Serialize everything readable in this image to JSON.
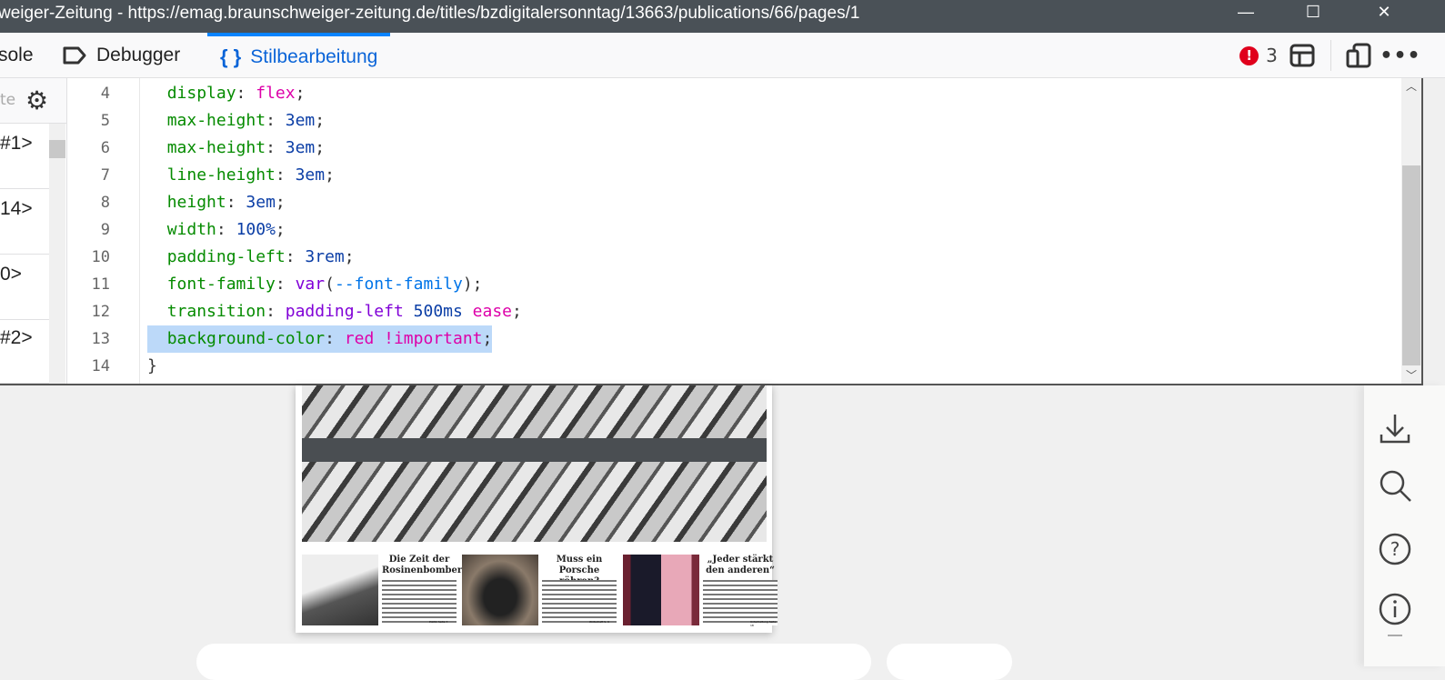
{
  "window": {
    "title": "weiger-Zeitung - https://emag.braunschweiger-zeitung.de/titles/bzdigitalersonntag/13663/publications/66/pages/1"
  },
  "devtools": {
    "tabs": [
      {
        "label": "sole",
        "icon": "console-icon"
      },
      {
        "label": "Debugger",
        "icon": "debugger-icon"
      },
      {
        "label": "Stilbearbeitung",
        "icon": "braces-icon",
        "active": true
      }
    ],
    "error_count": "3",
    "filter_placeholder": "te",
    "stylesheets": [
      "#1>",
      "14>",
      "0>",
      "#2>"
    ],
    "code_lines": [
      {
        "n": "4",
        "tokens": [
          [
            "  ",
            "punct"
          ],
          [
            "display",
            "prop"
          ],
          [
            ": ",
            "punct"
          ],
          [
            "flex",
            "kw"
          ],
          [
            ";",
            "punct"
          ]
        ]
      },
      {
        "n": "5",
        "tokens": [
          [
            "  ",
            "punct"
          ],
          [
            "max-height",
            "prop"
          ],
          [
            ": ",
            "punct"
          ],
          [
            "3em",
            "num"
          ],
          [
            ";",
            "punct"
          ]
        ]
      },
      {
        "n": "6",
        "tokens": [
          [
            "  ",
            "punct"
          ],
          [
            "max-height",
            "prop"
          ],
          [
            ": ",
            "punct"
          ],
          [
            "3em",
            "num"
          ],
          [
            ";",
            "punct"
          ]
        ]
      },
      {
        "n": "7",
        "tokens": [
          [
            "  ",
            "punct"
          ],
          [
            "line-height",
            "prop"
          ],
          [
            ": ",
            "punct"
          ],
          [
            "3em",
            "num"
          ],
          [
            ";",
            "punct"
          ]
        ]
      },
      {
        "n": "8",
        "tokens": [
          [
            "  ",
            "punct"
          ],
          [
            "height",
            "prop"
          ],
          [
            ": ",
            "punct"
          ],
          [
            "3em",
            "num"
          ],
          [
            ";",
            "punct"
          ]
        ]
      },
      {
        "n": "9",
        "tokens": [
          [
            "  ",
            "punct"
          ],
          [
            "width",
            "prop"
          ],
          [
            ": ",
            "punct"
          ],
          [
            "100%",
            "num"
          ],
          [
            ";",
            "punct"
          ]
        ]
      },
      {
        "n": "10",
        "tokens": [
          [
            "  ",
            "punct"
          ],
          [
            "padding-left",
            "prop"
          ],
          [
            ": ",
            "punct"
          ],
          [
            "3rem",
            "num"
          ],
          [
            ";",
            "punct"
          ]
        ]
      },
      {
        "n": "11",
        "tokens": [
          [
            "  ",
            "punct"
          ],
          [
            "font-family",
            "prop"
          ],
          [
            ": ",
            "punct"
          ],
          [
            "var",
            "fn"
          ],
          [
            "(",
            "punct"
          ],
          [
            "--font-family",
            "var"
          ],
          [
            ");",
            "punct"
          ]
        ]
      },
      {
        "n": "12",
        "tokens": [
          [
            "  ",
            "punct"
          ],
          [
            "transition",
            "prop"
          ],
          [
            ": ",
            "punct"
          ],
          [
            "padding-left",
            "fn"
          ],
          [
            " ",
            "punct"
          ],
          [
            "500ms",
            "num"
          ],
          [
            " ",
            "punct"
          ],
          [
            "ease",
            "kw"
          ],
          [
            ";",
            "punct"
          ]
        ]
      },
      {
        "n": "13",
        "highlighted": true,
        "tokens": [
          [
            "  ",
            "punct"
          ],
          [
            "background-color",
            "prop"
          ],
          [
            ": ",
            "punct"
          ],
          [
            "red",
            "kw"
          ],
          [
            " ",
            "punct"
          ],
          [
            "!important",
            "kw"
          ],
          [
            ";",
            "punct"
          ]
        ]
      },
      {
        "n": "14",
        "tokens": [
          [
            "}",
            "punct"
          ]
        ]
      }
    ]
  },
  "viewer": {
    "stories": [
      {
        "headline": "Die Zeit der Rosinenbomber",
        "ref": "Politik Seite 7"
      },
      {
        "headline": "Muss ein Porsche röhren?",
        "ref": "Wirtschaft S. 9"
      },
      {
        "headline": "„Jeder stärkt den anderen“",
        "ref": "Unterhaltung Seite 18"
      }
    ],
    "sidebar_icons": [
      "download-icon",
      "search-icon",
      "help-icon",
      "info-icon"
    ]
  }
}
